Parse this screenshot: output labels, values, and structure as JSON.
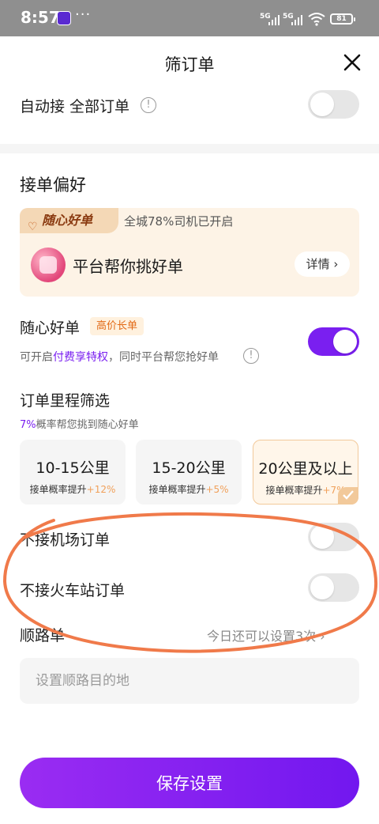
{
  "status_bar": {
    "time": "8:57",
    "dots": "···",
    "sig1": "5G",
    "sig2": "5G",
    "battery": "81"
  },
  "header": {
    "title": "筛订单"
  },
  "auto_accept": {
    "label": "自动接 全部订单",
    "enabled": false
  },
  "preference": {
    "section_title": "接单偏好",
    "card": {
      "brand": "随心好单",
      "stat": "全城78%司机已开启",
      "main_text": "平台帮你挑好单",
      "detail_label": "详情 ›"
    }
  },
  "suixin": {
    "label": "随心好单",
    "badge": "高价长单",
    "note_prefix": "可开启",
    "note_link": "付费享特权",
    "note_suffix": "，同时平台帮您抢好单",
    "enabled": true
  },
  "mileage": {
    "title": "订单里程筛选",
    "sub_pct": "7%",
    "sub_text": "概率帮您挑到随心好单",
    "options": [
      {
        "label": "10-15公里",
        "sub": "接单概率提升",
        "up": "+12%",
        "selected": false
      },
      {
        "label": "15-20公里",
        "sub": "接单概率提升",
        "up": "+5%",
        "selected": false
      },
      {
        "label": "20公里及以上",
        "sub": "接单概率提升",
        "up": "+7%",
        "selected": true
      }
    ]
  },
  "airport": {
    "label": "不接机场订单",
    "enabled": false
  },
  "train": {
    "label": "不接火车站订单",
    "enabled": false
  },
  "route": {
    "label": "顺路单",
    "right_text": "今日还可以设置3次 ›",
    "placeholder": "设置顺路目的地"
  },
  "save_label": "保存设置",
  "colors": {
    "accent": "#7a1ff0",
    "orange": "#e26a16",
    "annotation": "#f07a4a"
  }
}
